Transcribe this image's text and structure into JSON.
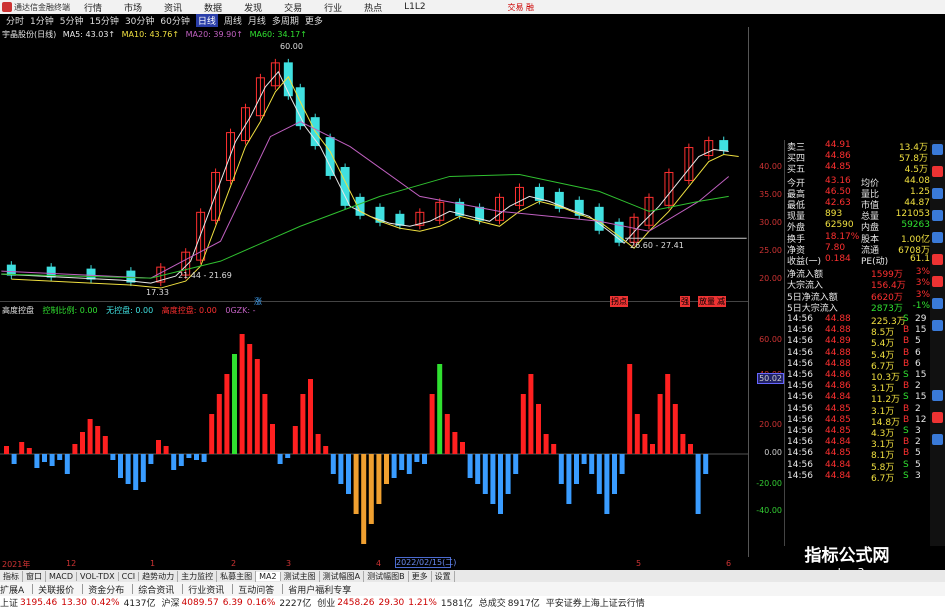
{
  "app": {
    "title": "通达信金融终端",
    "right_label": "交易  融"
  },
  "menu": [
    "行情",
    "市场",
    "资讯",
    "数据",
    "发现",
    "交易",
    "行业",
    "热点",
    "L1L2"
  ],
  "periods": [
    "分时",
    "1分钟",
    "5分钟",
    "15分钟",
    "30分钟",
    "60分钟",
    "日线",
    "周线",
    "月线",
    "多周期",
    "更多"
  ],
  "active_period": "日线",
  "main": {
    "stock": "宇晶股份(日线)",
    "ma5": "MA5: 43.03↑",
    "ma10": "MA10: 43.76↑",
    "ma20": "MA20: 39.90↑",
    "ma60": "MA60: 34.17↑",
    "high_label": "60.00",
    "low_label1": "17.33",
    "low_label2": "21.44 - 21.69",
    "range_label": "26.60 - 27.41",
    "axis": [
      "40.00",
      "35.00",
      "30.00",
      "25.00",
      "20.00"
    ]
  },
  "sub": {
    "name": "高度控盘",
    "f1": "控制比例: 0.00",
    "f2": "无控盘: 0.00",
    "f3": "高度控盘: 0.00",
    "f4": "0GZK: -",
    "badge1": "涨",
    "badge2": "拐点",
    "badge3": "强",
    "badge4": "放量",
    "badge5": "减",
    "axis": [
      "60.00",
      "40.00",
      "20.00",
      "0.00",
      "-20.00",
      "-40.00"
    ],
    "current": "50.02"
  },
  "dates": [
    "2021年",
    "12",
    "1",
    "2",
    "3",
    "4",
    "5",
    "6"
  ],
  "date_box": "2022/02/15(二)",
  "quote": {
    "top": [
      {
        "l": "卖三",
        "p": "44.91",
        "v": "13.4万"
      },
      {
        "l": "买四",
        "p": "44.86",
        "v": "57.8万"
      },
      {
        "l": "买五",
        "p": "44.85",
        "v": "4.5万"
      }
    ],
    "stats": [
      {
        "l": "今开",
        "p": "43.16",
        "l2": "均价",
        "v": "44.08"
      },
      {
        "l": "最高",
        "p": "46.50",
        "l2": "量比",
        "v": "1.25"
      },
      {
        "l": "最低",
        "p": "42.63",
        "l2": "市值",
        "v": "44.87"
      },
      {
        "l": "现量",
        "p": "893",
        "l2": "总量",
        "v": "121053"
      },
      {
        "l": "外盘",
        "p": "62590",
        "l2": "内盘",
        "v": "59263"
      },
      {
        "l": "换手",
        "p": "18.17%",
        "l2": "股本",
        "v": "1.00亿"
      },
      {
        "l": "净资",
        "p": "7.80",
        "l2": "流通",
        "v": "6708万"
      },
      {
        "l": "收益(一)",
        "p": "0.184",
        "l2": "PE(动)",
        "v": "61.1"
      }
    ],
    "flows": [
      {
        "l": "净流入额",
        "v": "1599万",
        "p": "3%"
      },
      {
        "l": "大宗流入",
        "v": "156.4万",
        "p": "3%"
      },
      {
        "l": "5日净流入额",
        "v": "6620万",
        "p": "3%"
      },
      {
        "l": "5日大宗流入",
        "v": "2873万",
        "p": "-1%"
      }
    ],
    "ticks": [
      {
        "t": "14:56",
        "p": "44.88",
        "v": "225.3万",
        "f": "S",
        "d": "29"
      },
      {
        "t": "14:56",
        "p": "44.88",
        "v": "8.5万",
        "f": "B",
        "d": "15"
      },
      {
        "t": "14:56",
        "p": "44.89",
        "v": "5.4万",
        "f": "B",
        "d": "5"
      },
      {
        "t": "14:56",
        "p": "44.88",
        "v": "5.4万",
        "f": "B",
        "d": "6"
      },
      {
        "t": "14:56",
        "p": "44.88",
        "v": "6.7万",
        "f": "B",
        "d": "6"
      },
      {
        "t": "14:56",
        "p": "44.86",
        "v": "10.3万",
        "f": "S",
        "d": "15"
      },
      {
        "t": "14:56",
        "p": "44.86",
        "v": "3.1万",
        "f": "B",
        "d": "2"
      },
      {
        "t": "14:56",
        "p": "44.84",
        "v": "11.2万",
        "f": "S",
        "d": "15"
      },
      {
        "t": "14:56",
        "p": "44.85",
        "v": "3.1万",
        "f": "B",
        "d": "2"
      },
      {
        "t": "14:56",
        "p": "44.85",
        "v": "14.8万",
        "f": "B",
        "d": "12"
      },
      {
        "t": "14:56",
        "p": "44.85",
        "v": "4.3万",
        "f": "S",
        "d": "3"
      },
      {
        "t": "14:56",
        "p": "44.84",
        "v": "3.1万",
        "f": "B",
        "d": "2"
      },
      {
        "t": "14:56",
        "p": "44.85",
        "v": "8.1万",
        "f": "B",
        "d": "5"
      },
      {
        "t": "14:56",
        "p": "44.84",
        "v": "5.8万",
        "f": "S",
        "d": "5"
      },
      {
        "t": "14:56",
        "p": "44.84",
        "v": "6.7万",
        "f": "S",
        "d": "3"
      }
    ]
  },
  "tabs": [
    "指标",
    "窗口",
    "MACD",
    "VOL-TDX",
    "CCI",
    "趋势动力",
    "主力监控",
    "私募主图",
    "MA2",
    "测试主图",
    "测试幅图A",
    "测试幅图B",
    "更多",
    "设置"
  ],
  "status": {
    "n1": "扩展A",
    "n2": "关联报价",
    "n3": "资金分布",
    "n4": "综合资讯",
    "n5": "行业资讯",
    "n6": "互动问答",
    "n7": "省用户福利专享"
  },
  "bottom": {
    "sh_label": "上证",
    "sh": "3195.46",
    "sh_chg": "13.30",
    "sh_pct": "0.42%",
    "sh_amt": "4137亿",
    "sz_label": "沪深",
    "sz": "4089.57",
    "sz_chg": "6.39",
    "sz_pct": "0.16%",
    "sz_amt": "2227亿",
    "cy_label": "创业",
    "cy": "2458.26",
    "cy_chg": "29.30",
    "cy_pct": "1.21%",
    "cy_amt": "1581亿",
    "total_label": "总成交",
    "total": "8917亿",
    "broker": "平安证券上海上证云行情"
  },
  "watermark": {
    "line1": "指标公式网",
    "line2": "www.zbgs3.com"
  },
  "colors": {
    "up": "#ff3030",
    "down": "#30e030",
    "bar_blue": "#3a9cff",
    "bar_orange": "#f0a030"
  }
}
